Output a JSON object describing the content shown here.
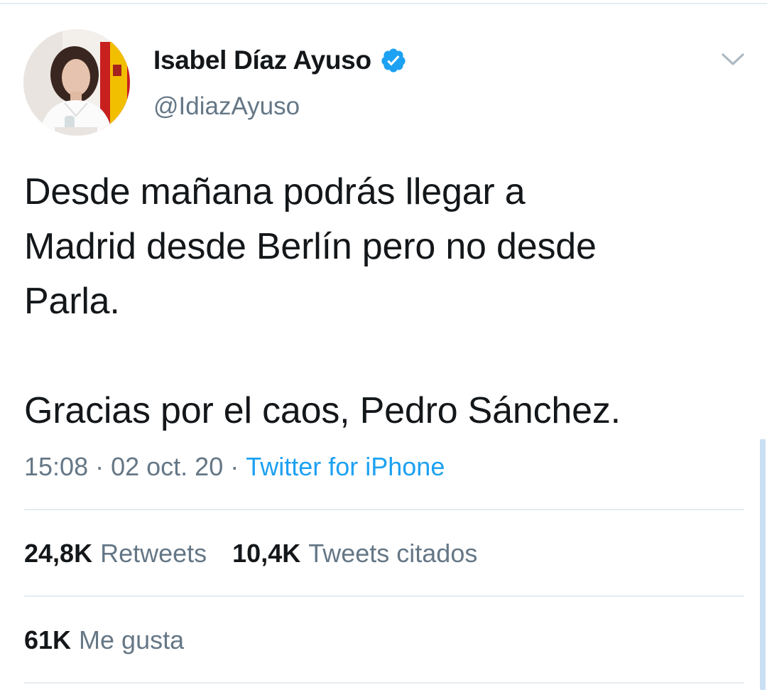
{
  "author": {
    "display_name": "Isabel Díaz Ayuso",
    "handle": "@IdiazAyuso",
    "verified": true,
    "verified_icon": "verified-badge-icon"
  },
  "tweet": {
    "text": "Desde mañana podrás llegar a\nMadrid desde Berlín pero no desde\nParla.\n\nGracias por el caos, Pedro Sánchez.",
    "time": "15:08",
    "date": "02 oct. 20",
    "separator": "·",
    "source": "Twitter for iPhone"
  },
  "stats": {
    "retweets_count": "24,8K",
    "retweets_label": "Retweets",
    "quotes_count": "10,4K",
    "quotes_label": "Tweets citados",
    "likes_count": "61K",
    "likes_label": "Me gusta"
  },
  "icons": {
    "menu": "chevron-down-icon"
  },
  "colors": {
    "text_primary": "#14171a",
    "text_secondary": "#657786",
    "link": "#1da1f2",
    "verified": "#1da1f2",
    "divider": "#e6ecf0"
  }
}
